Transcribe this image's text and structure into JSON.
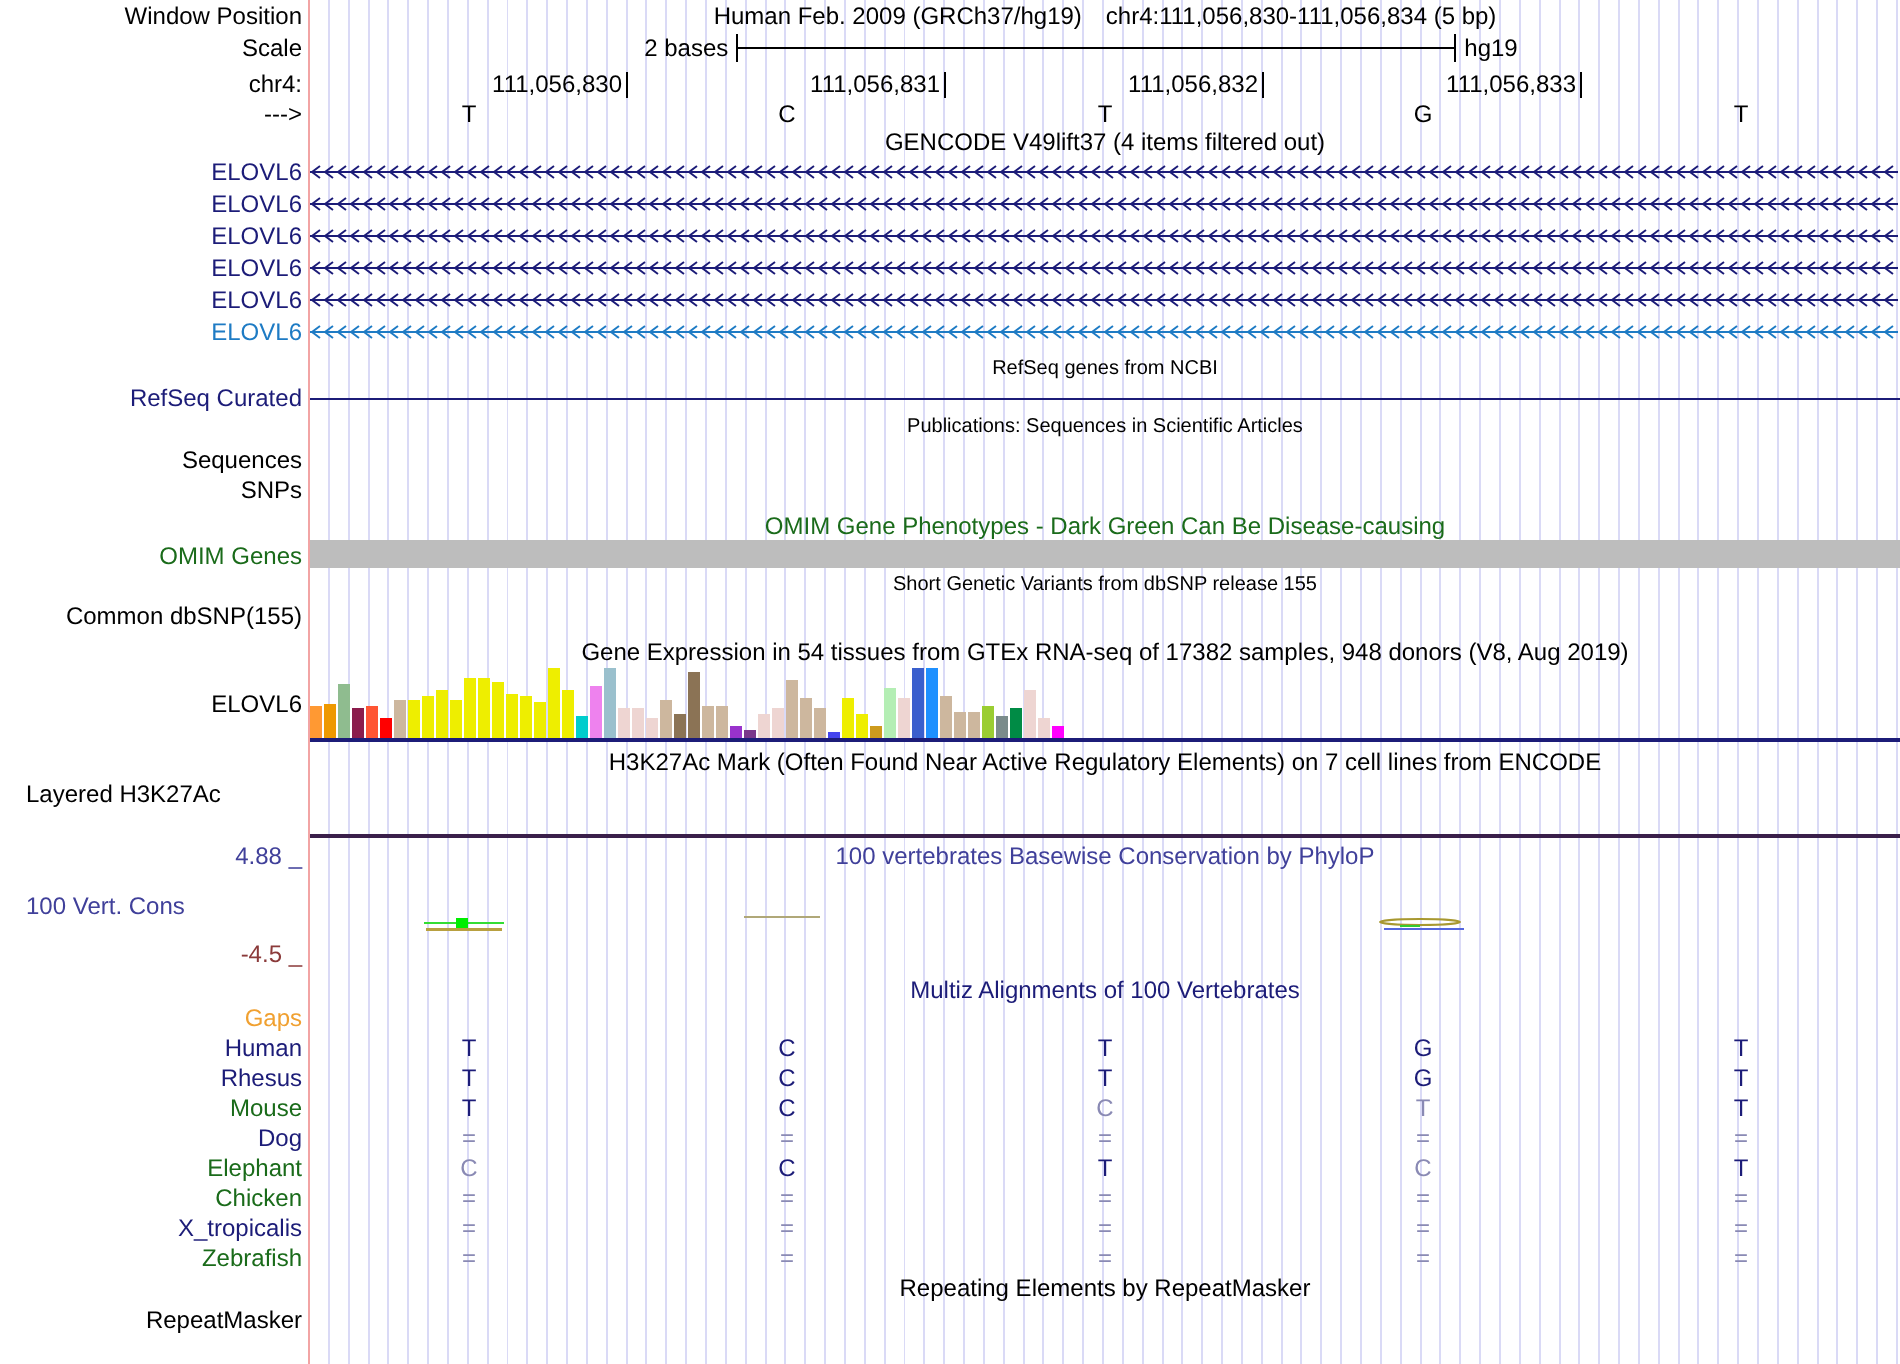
{
  "header": {
    "label": "Window Position",
    "assembly": "Human Feb. 2009 (GRCh37/hg19)",
    "position": "chr4:111,056,830-111,056,834 (5 bp)"
  },
  "scale": {
    "label": "Scale",
    "span": "2 bases",
    "assembly": "hg19"
  },
  "ruler": {
    "label": "chr4:",
    "positions": [
      "111,056,830",
      "111,056,831",
      "111,056,832",
      "111,056,833"
    ]
  },
  "sequence": {
    "label": "--->",
    "bases": [
      "T",
      "C",
      "T",
      "G",
      "T"
    ]
  },
  "gencode": {
    "title": "GENCODE V49lift37 (4 items filtered out)",
    "items": [
      {
        "label": "ELOVL6",
        "color": "#1c1c78"
      },
      {
        "label": "ELOVL6",
        "color": "#1c1c78"
      },
      {
        "label": "ELOVL6",
        "color": "#1c1c78"
      },
      {
        "label": "ELOVL6",
        "color": "#1c1c78"
      },
      {
        "label": "ELOVL6",
        "color": "#1c1c78"
      },
      {
        "label": "ELOVL6",
        "color": "#1e7bc4"
      }
    ]
  },
  "refseq": {
    "title": "RefSeq genes from NCBI",
    "label": "RefSeq Curated"
  },
  "publications": {
    "title": "Publications: Sequences in Scientific Articles",
    "labels": [
      "Sequences",
      "SNPs"
    ]
  },
  "omim": {
    "title": "OMIM Gene Phenotypes - Dark Green Can Be Disease-causing",
    "label": "OMIM Genes"
  },
  "dbsnp": {
    "title": "Short Genetic Variants from dbSNP release 155",
    "label": "Common dbSNP(155)"
  },
  "gtex": {
    "title": "Gene Expression in 54 tissues from GTEx RNA-seq of 17382 samples, 948 donors (V8, Aug 2019)",
    "label": "ELOVL6"
  },
  "h3k27ac": {
    "title": "H3K27Ac Mark (Often Found Near Active Regulatory Elements) on 7 cell lines from ENCODE",
    "label": "Layered H3K27Ac"
  },
  "phylop": {
    "title": "100 vertebrates Basewise Conservation by PhyloP",
    "label": "100 Vert. Cons",
    "max": "4.88 _",
    "min": "-4.5 _"
  },
  "multiz": {
    "title": "Multiz Alignments of 100 Vertebrates",
    "gaps_label": "Gaps",
    "species": [
      {
        "name": "Human",
        "color": "#1c1c78",
        "bases": [
          {
            "base": "T",
            "faded": false
          },
          {
            "base": "C",
            "faded": false
          },
          {
            "base": "T",
            "faded": false
          },
          {
            "base": "G",
            "faded": false
          },
          {
            "base": "T",
            "faded": false
          }
        ]
      },
      {
        "name": "Rhesus",
        "color": "#1c1c78",
        "bases": [
          {
            "base": "T",
            "faded": false
          },
          {
            "base": "C",
            "faded": false
          },
          {
            "base": "T",
            "faded": false
          },
          {
            "base": "G",
            "faded": false
          },
          {
            "base": "T",
            "faded": false
          }
        ]
      },
      {
        "name": "Mouse",
        "color": "#1a6b1a",
        "bases": [
          {
            "base": "T",
            "faded": false
          },
          {
            "base": "C",
            "faded": false
          },
          {
            "base": "C",
            "faded": true
          },
          {
            "base": "T",
            "faded": true
          },
          {
            "base": "T",
            "faded": false
          }
        ]
      },
      {
        "name": "Dog",
        "color": "#1c1c78",
        "bases": [
          {
            "base": "=",
            "faded": true
          },
          {
            "base": "=",
            "faded": true
          },
          {
            "base": "=",
            "faded": true
          },
          {
            "base": "=",
            "faded": true
          },
          {
            "base": "=",
            "faded": true
          }
        ]
      },
      {
        "name": "Elephant",
        "color": "#1a6b1a",
        "bases": [
          {
            "base": "C",
            "faded": true
          },
          {
            "base": "C",
            "faded": false
          },
          {
            "base": "T",
            "faded": false
          },
          {
            "base": "C",
            "faded": true
          },
          {
            "base": "T",
            "faded": false
          }
        ]
      },
      {
        "name": "Chicken",
        "color": "#1a6b1a",
        "bases": [
          {
            "base": "=",
            "faded": true
          },
          {
            "base": "=",
            "faded": true
          },
          {
            "base": "=",
            "faded": true
          },
          {
            "base": "=",
            "faded": true
          },
          {
            "base": "=",
            "faded": true
          }
        ]
      },
      {
        "name": "X_tropicalis",
        "color": "#1c1c78",
        "bases": [
          {
            "base": "=",
            "faded": true
          },
          {
            "base": "=",
            "faded": true
          },
          {
            "base": "=",
            "faded": true
          },
          {
            "base": "=",
            "faded": true
          },
          {
            "base": "=",
            "faded": true
          }
        ]
      },
      {
        "name": "Zebrafish",
        "color": "#1a6b1a",
        "bases": [
          {
            "base": "=",
            "faded": true
          },
          {
            "base": "=",
            "faded": true
          },
          {
            "base": "=",
            "faded": true
          },
          {
            "base": "=",
            "faded": true
          },
          {
            "base": "=",
            "faded": true
          }
        ]
      }
    ]
  },
  "repeatmasker": {
    "title": "Repeating Elements by RepeatMasker",
    "label": "RepeatMasker"
  }
}
